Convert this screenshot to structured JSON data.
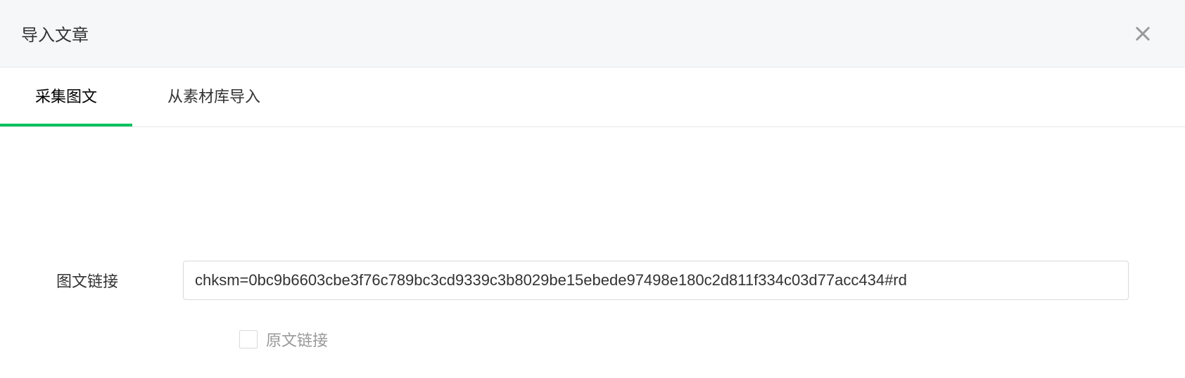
{
  "dialog": {
    "title": "导入文章"
  },
  "tabs": {
    "collect": "采集图文",
    "library": "从素材库导入"
  },
  "form": {
    "url_label": "图文链接",
    "url_value": "chksm=0bc9b6603cbe3f76c789bc3cd9339c3b8029be15ebede97498e180c2d811f334c03d77acc434#rd",
    "original_link_label": "原文链接"
  }
}
